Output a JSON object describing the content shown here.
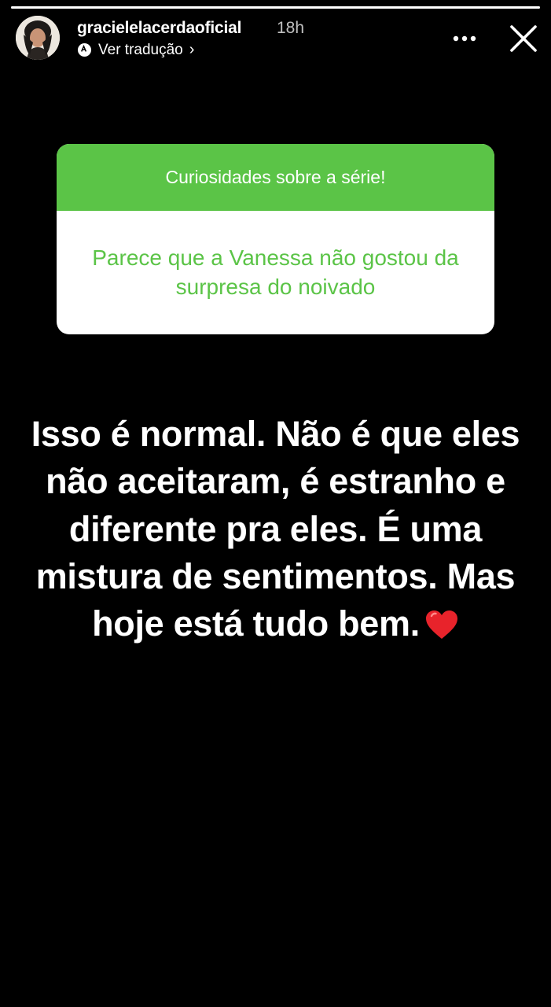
{
  "story": {
    "progress_fraction": 1.0,
    "username": "gracielelacerdaoficial",
    "time_ago": "18h",
    "translate_label": "Ver tradução",
    "translate_chevron": "›",
    "more_icon": "more-horizontal-icon",
    "close_icon": "close-icon"
  },
  "question_sticker": {
    "header": "Curiosidades sobre a série!",
    "question": "Parece que a Vanessa não gostou da surpresa do noivado",
    "accent_color": "#5bc447"
  },
  "answer": {
    "text": "Isso é normal. Não é que eles não aceitaram, é estranho e diferente pra eles. É uma mistura de sentimentos. Mas hoje está tudo bem.",
    "emoji_icon": "red-heart-icon"
  }
}
